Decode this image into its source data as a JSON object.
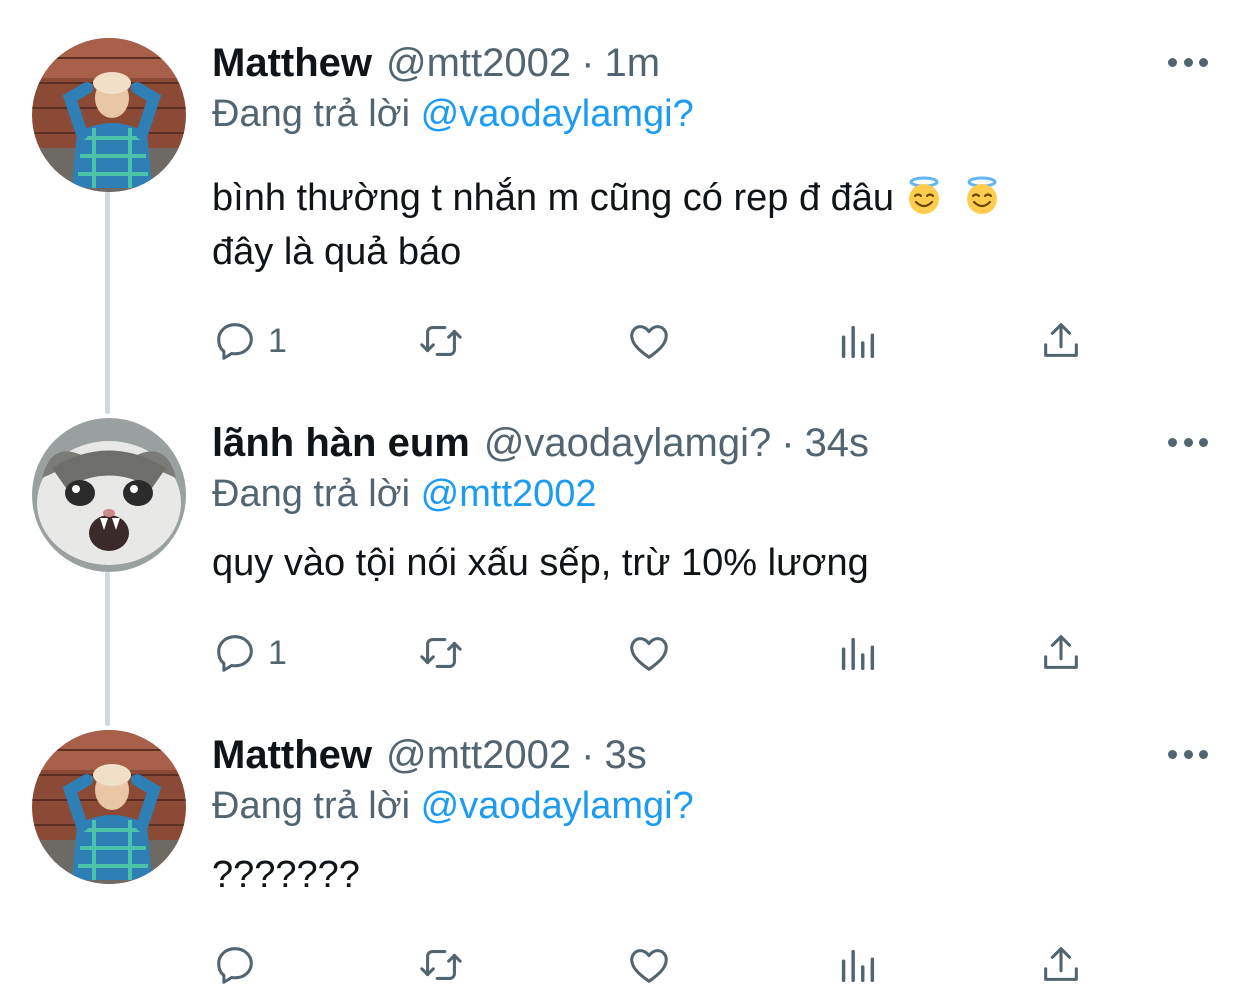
{
  "colors": {
    "text": "#0f1419",
    "secondary": "#536471",
    "accent": "#1d9bf0",
    "thread_line": "#cfd9de"
  },
  "replying_prefix": "Đang trả lời",
  "tweets": [
    {
      "name": "Matthew",
      "handle": "@mtt2002",
      "separator": "·",
      "time": "1m",
      "reply_to": "@vaodaylamgi?",
      "text_line1": "bình thường t nhắn m cũng có rep đ đâu",
      "text_line2": "đây là quả báo",
      "emojis": [
        "smiling-face-with-halo",
        "smiling-face-with-halo"
      ],
      "reply_count": "1"
    },
    {
      "name": "lãnh hàn eum",
      "handle": "@vaodaylamgi?",
      "separator": "·",
      "time": "34s",
      "reply_to": "@mtt2002",
      "text_line1": "quy vào tội nói xấu sếp, trừ 10% lương",
      "reply_count": "1"
    },
    {
      "name": "Matthew",
      "handle": "@mtt2002",
      "separator": "·",
      "time": "3s",
      "reply_to": "@vaodaylamgi?",
      "text_line1": "???????",
      "reply_count": ""
    }
  ]
}
